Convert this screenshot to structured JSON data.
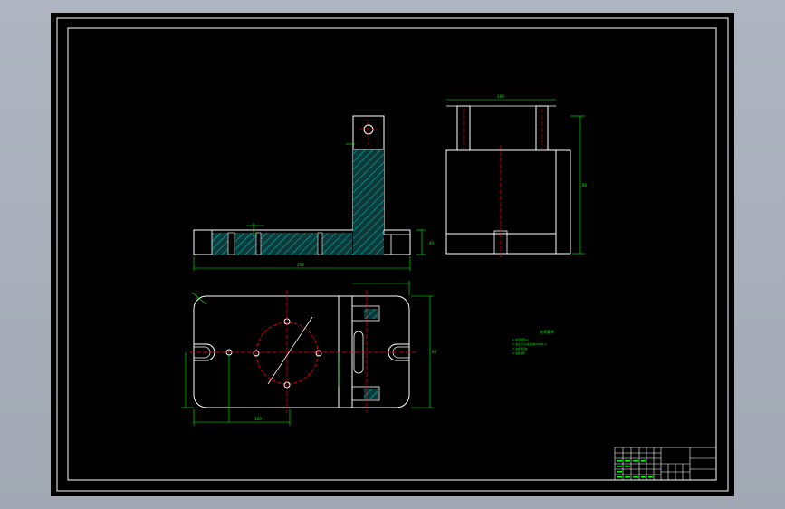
{
  "viewport": {
    "background_color": "#a8afba",
    "paper_color": "#000000",
    "frame_color": "#ffffff",
    "geometry_color": "#ffffff",
    "dimension_color": "#00ff00",
    "centerline_color": "#ff0000",
    "hatch_color": "#00cccc",
    "titleblock_color": "#ffffff"
  },
  "notes": {
    "heading": "技术要求",
    "lines": [
      "1. 未注倒角C1",
      "2. 未注尺寸公差按GB/T1804-m",
      "3. 去毛刺锐边",
      "4. 调质处理"
    ]
  },
  "dimension_labels": {
    "front_total_length": "250",
    "front_height": "40",
    "side_height": "80",
    "side_width": "100",
    "plan_length": "120",
    "plan_depth": "60"
  }
}
